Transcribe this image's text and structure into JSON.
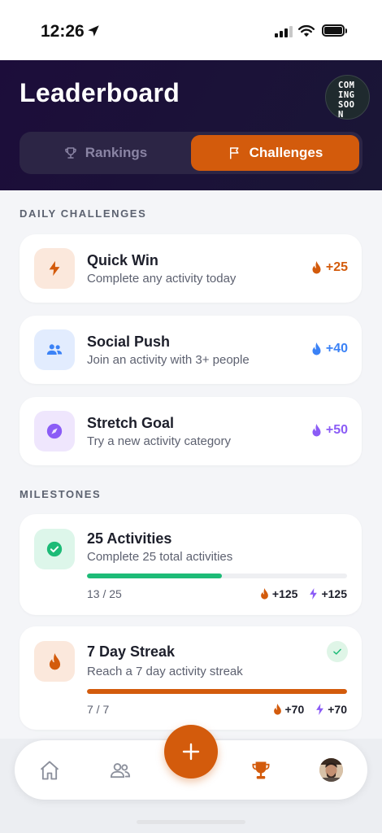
{
  "status_bar": {
    "time": "12:26"
  },
  "header": {
    "title": "Leaderboard",
    "badge_lines": [
      "COM",
      "ING",
      "SOO",
      "N"
    ],
    "tabs": [
      {
        "label": "Rankings",
        "icon": "trophy-icon",
        "active": false
      },
      {
        "label": "Challenges",
        "icon": "flag-icon",
        "active": true
      }
    ]
  },
  "daily": {
    "label": "DAILY CHALLENGES",
    "items": [
      {
        "title": "Quick Win",
        "subtitle": "Complete any activity today",
        "reward": "+25",
        "icon": "lightning-icon",
        "color": "#d35b0c"
      },
      {
        "title": "Social Push",
        "subtitle": "Join an activity with 3+ people",
        "reward": "+40",
        "icon": "people-icon",
        "color": "#3b82f6"
      },
      {
        "title": "Stretch Goal",
        "subtitle": "Try a new activity category",
        "reward": "+50",
        "icon": "compass-icon",
        "color": "#8b5cf6"
      }
    ]
  },
  "milestones": {
    "label": "MILESTONES",
    "items": [
      {
        "title": "25 Activities",
        "subtitle": "Complete 25 total activities",
        "progress_text": "13 / 25",
        "progress": 0.52,
        "flame_points": "+125",
        "bolt_points": "+125",
        "icon": "check-circle-icon",
        "color": "#1dbb77",
        "completed": false
      },
      {
        "title": "7 Day Streak",
        "subtitle": "Reach a 7 day activity streak",
        "progress_text": "7 / 7",
        "progress": 1.0,
        "flame_points": "+70",
        "bolt_points": "+70",
        "icon": "flame-icon",
        "color": "#d35b0c",
        "completed": true
      }
    ]
  },
  "colors": {
    "accent": "#d35b0c",
    "header_bg": "#1c0d3a",
    "bolt": "#8b5cf6"
  },
  "nav": {
    "items": [
      "home-icon",
      "people-icon",
      "add-icon",
      "trophy-icon",
      "avatar"
    ],
    "active": "trophy-icon"
  }
}
